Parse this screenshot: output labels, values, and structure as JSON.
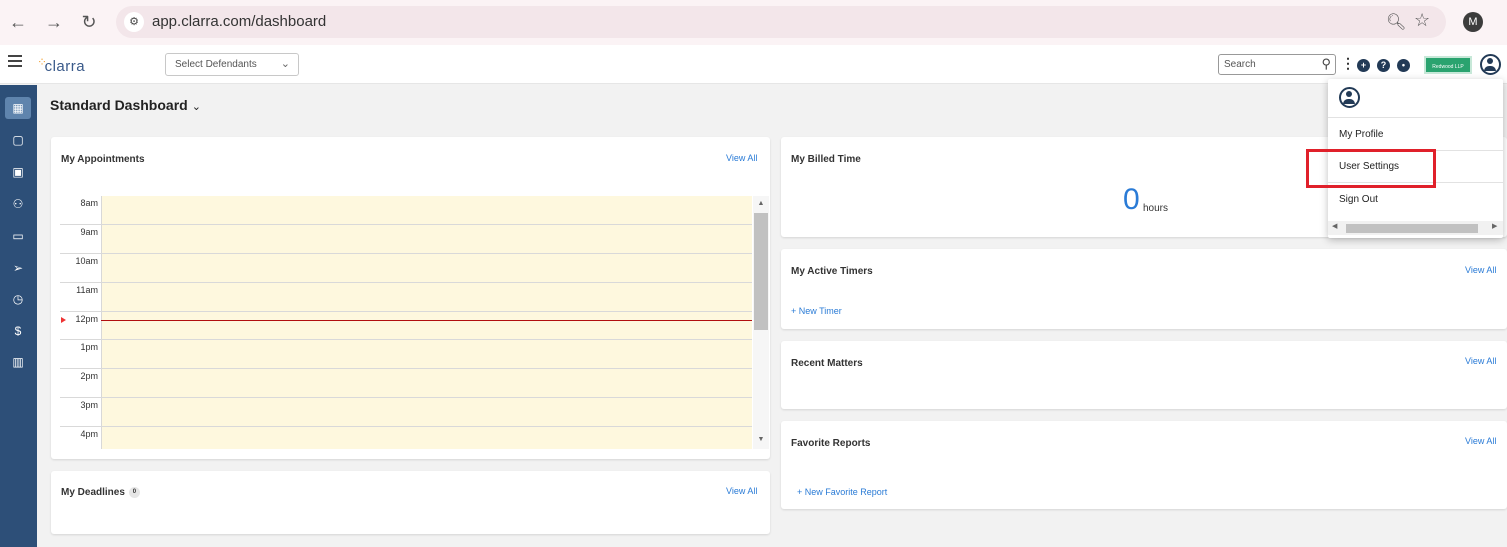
{
  "browser": {
    "url": "app.clarra.com/dashboard",
    "profile_initial": "M"
  },
  "header": {
    "logo_text": "clarra",
    "defendant_select": "Select Defendants",
    "search_placeholder": "Search",
    "firm_logo_text": "Redwood LLP"
  },
  "dashboard": {
    "title": "Standard Dashboard"
  },
  "appointments": {
    "title": "My Appointments",
    "view_all": "View All",
    "hours": [
      "8am",
      "9am",
      "10am",
      "11am",
      "12pm",
      "1pm",
      "2pm",
      "3pm",
      "4pm"
    ]
  },
  "deadlines": {
    "title": "My Deadlines",
    "count": "0",
    "view_all": "View All"
  },
  "billed_time": {
    "title": "My Billed Time",
    "value": "0",
    "unit": "hours"
  },
  "active_timers": {
    "title": "My Active Timers",
    "view_all": "View All",
    "new_timer": "+ New Timer"
  },
  "recent_matters": {
    "title": "Recent Matters",
    "view_all": "View All"
  },
  "favorite_reports": {
    "title": "Favorite Reports",
    "view_all": "View All",
    "new_report": "+ New Favorite Report"
  },
  "user_menu": {
    "items": [
      {
        "label": "My Profile"
      },
      {
        "label": "User Settings"
      },
      {
        "label": "Sign Out"
      }
    ]
  },
  "colors": {
    "sidebar": "#2d4f78",
    "link": "#2a7bd6",
    "highlight": "#e0202a",
    "calendar_bg": "#fef8de"
  }
}
